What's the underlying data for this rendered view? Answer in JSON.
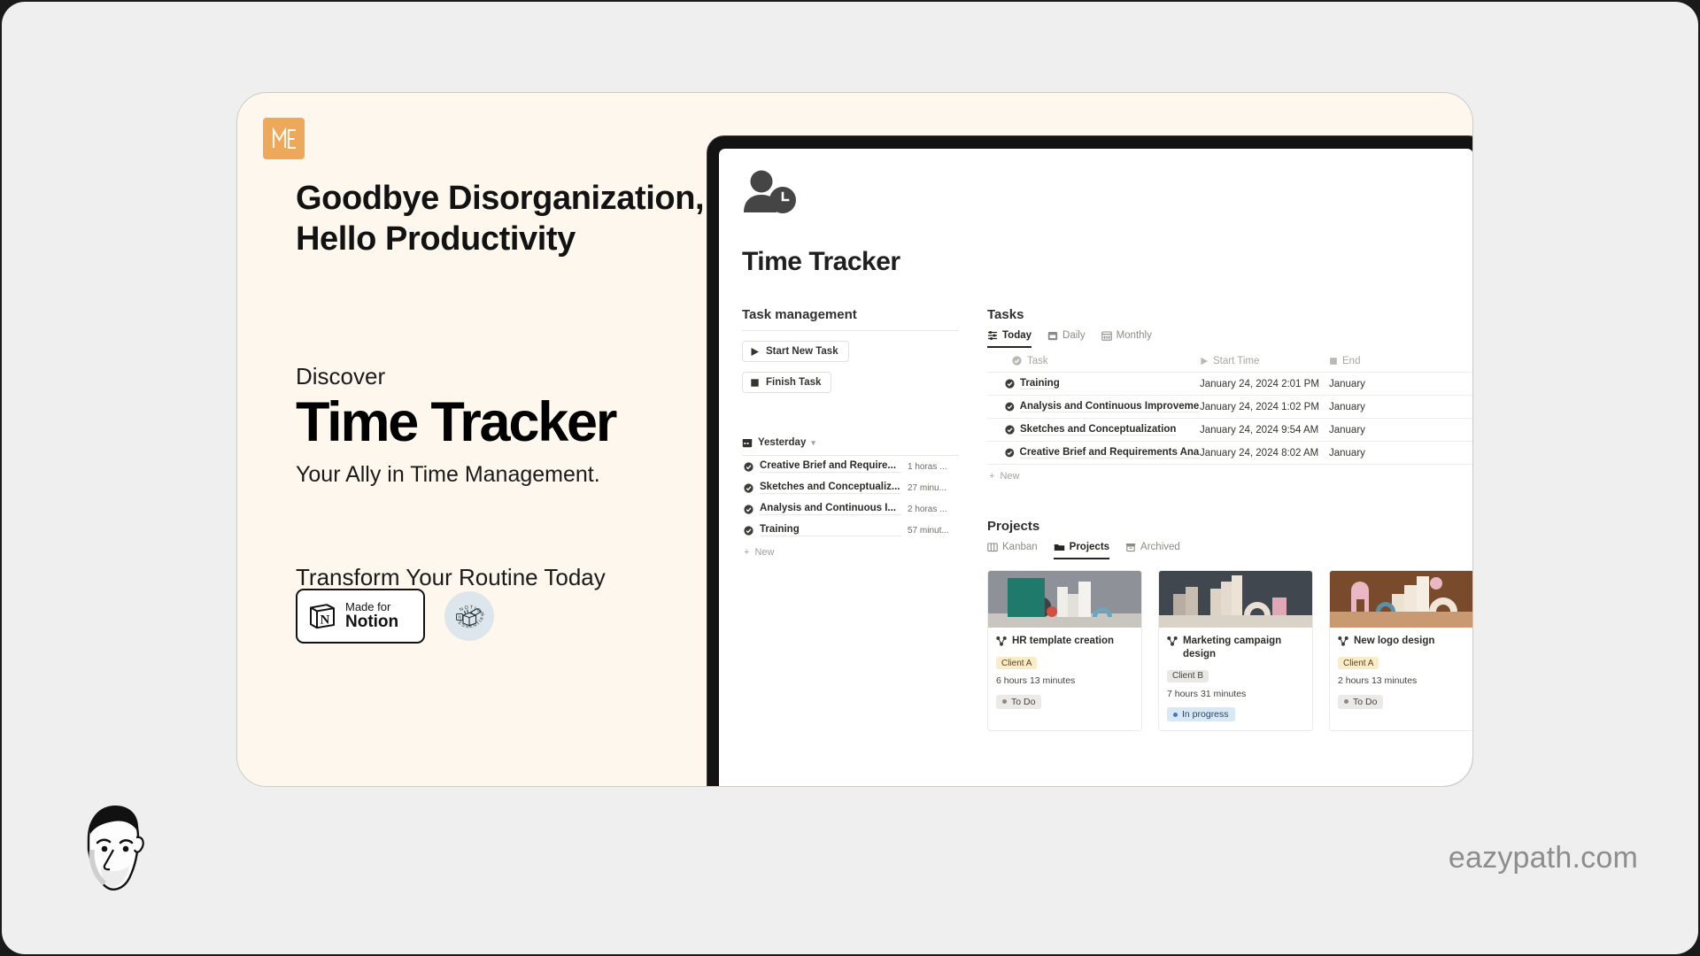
{
  "brand": {
    "logo_text": "ME",
    "logo_color": "#eda85a"
  },
  "promo": {
    "headline_line1": "Goodbye Disorganization,",
    "headline_line2": "Hello Productivity",
    "discover_label": "Discover",
    "hero_title": "Time Tracker",
    "hero_subtitle": "Your Ally in Time Management.",
    "cta": "Transform Your Routine Today"
  },
  "badges": {
    "notion": {
      "small": "Made for",
      "big": "Notion",
      "icon": "notion-cube-icon"
    },
    "essentials": {
      "top_text": "NOTION",
      "bottom_text": "ESSENTIALS",
      "icon": "open-box-icon",
      "color": "#dde6ec"
    }
  },
  "app": {
    "icon": "person-clock-icon",
    "title": "Time Tracker",
    "task_management": {
      "heading": "Task management",
      "buttons": [
        {
          "label": "Start New Task",
          "icon": "play-icon"
        },
        {
          "label": "Finish Task",
          "icon": "stop-icon"
        }
      ],
      "group": {
        "label": "Yesterday",
        "icon": "calendar-icon",
        "chevron": "chevron-down-icon",
        "rows": [
          {
            "name": "Creative Brief and Require...",
            "duration": "1 horas ..."
          },
          {
            "name": "Sketches and Conceptualiz...",
            "duration": "27 minu..."
          },
          {
            "name": "Analysis and Continuous I...",
            "duration": "2 horas ..."
          },
          {
            "name": "Training",
            "duration": "57 minut..."
          }
        ],
        "new_label": "New"
      }
    },
    "tasks": {
      "heading": "Tasks",
      "tabs": [
        {
          "label": "Today",
          "icon": "list-settings-icon",
          "active": true
        },
        {
          "label": "Daily",
          "icon": "calendar-day-icon",
          "active": false
        },
        {
          "label": "Monthly",
          "icon": "calendar-month-icon",
          "active": false
        }
      ],
      "columns": [
        {
          "label": "Task",
          "icon": "check-circle-icon"
        },
        {
          "label": "Start Time",
          "icon": "play-icon"
        },
        {
          "label": "End",
          "icon": "stop-icon"
        }
      ],
      "rows": [
        {
          "name": "Training",
          "start": "January 24, 2024 2:01 PM",
          "end": "January"
        },
        {
          "name": "Analysis and Continuous Improvemen",
          "start": "January 24, 2024 1:02 PM",
          "end": "January"
        },
        {
          "name": "Sketches and Conceptualization",
          "start": "January 24, 2024 9:54 AM",
          "end": "January"
        },
        {
          "name": "Creative Brief and Requirements Analy",
          "start": "January 24, 2024 8:02 AM",
          "end": "January"
        }
      ],
      "new_label": "New"
    },
    "projects": {
      "heading": "Projects",
      "tabs": [
        {
          "label": "Kanban",
          "icon": "board-icon",
          "active": false
        },
        {
          "label": "Projects",
          "icon": "folder-icon",
          "active": true
        },
        {
          "label": "Archived",
          "icon": "archive-icon",
          "active": false
        }
      ],
      "cards": [
        {
          "title": "HR template creation",
          "icon": "relation-icon",
          "client": "Client A",
          "client_style": "client-a",
          "duration": "6 hours 13 minutes",
          "status": "To Do",
          "status_style": "todo",
          "thumb_bg": "#8e9197",
          "thumb_accent": "#1f7a6b"
        },
        {
          "title": "Marketing campaign design",
          "icon": "relation-icon",
          "client": "Client B",
          "client_style": "client-b",
          "duration": "7 hours 31 minutes",
          "status": "In progress",
          "status_style": "progress",
          "thumb_bg": "#41474f",
          "thumb_accent": "#cdbfae"
        },
        {
          "title": "New logo design",
          "icon": "relation-icon",
          "client": "Client A",
          "client_style": "client-a",
          "duration": "2 hours 13 minutes",
          "status": "To Do",
          "status_style": "todo",
          "thumb_bg": "#7a4a2c",
          "thumb_accent": "#e4b9c4"
        }
      ]
    }
  },
  "footer": {
    "avatar": "person-illustration-avatar",
    "watermark": "eazypath.com"
  }
}
